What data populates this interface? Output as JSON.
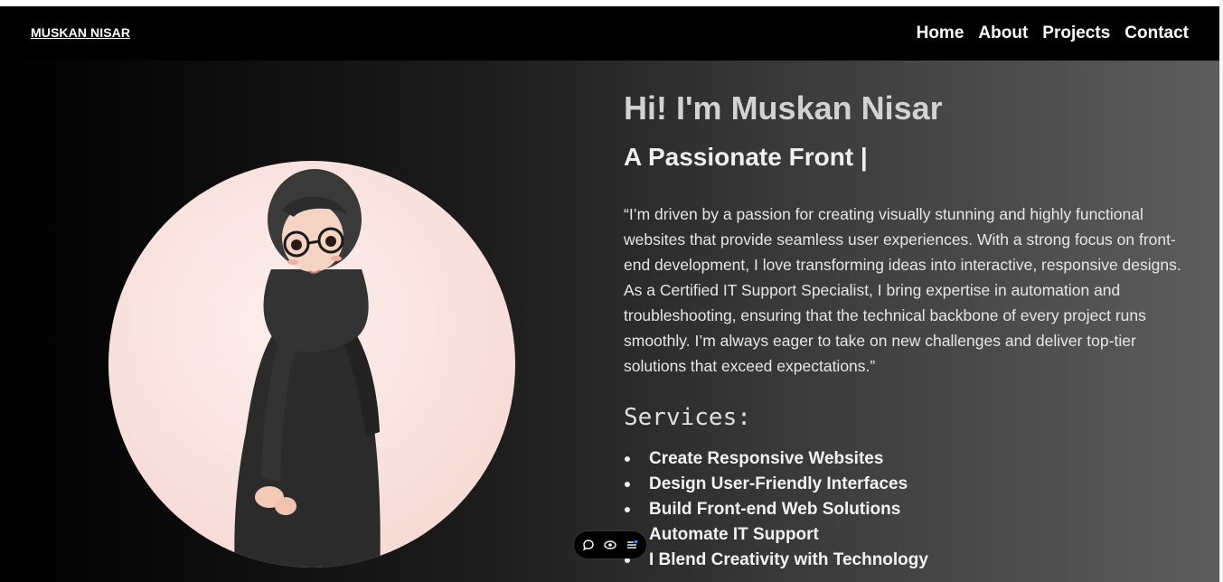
{
  "nav": {
    "logo": "MUSKAN NISAR",
    "links": [
      "Home",
      "About",
      "Projects",
      "Contact"
    ]
  },
  "hero": {
    "title": "Hi! I'm Muskan Nisar",
    "subtitle": "A Passionate Front |",
    "intro": "“I’m driven by a passion for creating visually stunning and highly functional websites that provide seamless user experiences. With a strong focus on front-end development, I love transforming ideas into interactive, responsive designs. As a Certified IT Support Specialist, I bring expertise in automation and troubleshooting, ensuring that the technical backbone of every project runs smoothly. I’m always eager to take on new challenges and deliver top-tier solutions that exceed expectations.”",
    "services_heading": "Services:",
    "services": [
      "Create Responsive Websites",
      "Design User-Friendly Interfaces",
      "Build Front-end Web Solutions",
      "Automate IT Support",
      "I Blend Creativity with Technology"
    ]
  },
  "toolbar": {
    "icons": [
      "chat-bubble-icon",
      "eye-icon",
      "list-settings-icon"
    ]
  },
  "colors": {
    "nav_background": "#000000",
    "gradient_start": "#000000",
    "gradient_end": "#5d5d5d",
    "avatar_background": "#f8dfdb"
  }
}
